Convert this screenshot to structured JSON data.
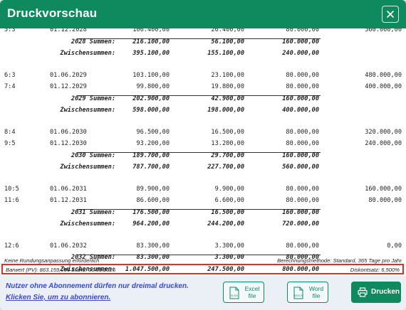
{
  "dialog": {
    "title": "Druckvorschau",
    "close_icon": "close-icon"
  },
  "table": {
    "rows": [
      {
        "type": "row",
        "id": "5:3",
        "date": "01.12.2028",
        "v1": "106.400,00",
        "v2": "26.400,00",
        "v3": "80.000,00",
        "v4": "560.000,00"
      },
      {
        "type": "sum",
        "label": "2028 Summen:",
        "v1": "216.100,00",
        "v2": "56.100,00",
        "v3": "160.000,00",
        "v4": ""
      },
      {
        "type": "sum",
        "label": "Zwischensummen:",
        "v1": "395.100,00",
        "v2": "155.100,00",
        "v3": "240.000,00",
        "v4": ""
      },
      {
        "type": "row",
        "id": "6:3",
        "date": "01.06.2029",
        "v1": "103.100,00",
        "v2": "23.100,00",
        "v3": "80.000,00",
        "v4": "480.000,00"
      },
      {
        "type": "row",
        "id": "7:4",
        "date": "01.12.2029",
        "v1": "99.800,00",
        "v2": "19.800,00",
        "v3": "80.000,00",
        "v4": "400.000,00"
      },
      {
        "type": "sum",
        "label": "2029 Summen:",
        "v1": "202.900,00",
        "v2": "42.900,00",
        "v3": "160.000,00",
        "v4": ""
      },
      {
        "type": "sum",
        "label": "Zwischensummen:",
        "v1": "598.000,00",
        "v2": "198.000,00",
        "v3": "400.000,00",
        "v4": ""
      },
      {
        "type": "row",
        "id": "8:4",
        "date": "01.06.2030",
        "v1": "96.500,00",
        "v2": "16.500,00",
        "v3": "80.000,00",
        "v4": "320.000,00"
      },
      {
        "type": "row",
        "id": "9:5",
        "date": "01.12.2030",
        "v1": "93.200,00",
        "v2": "13.200,00",
        "v3": "80.000,00",
        "v4": "240.000,00"
      },
      {
        "type": "sum",
        "label": "2030 Summen:",
        "v1": "189.700,00",
        "v2": "29.700,00",
        "v3": "160.000,00",
        "v4": ""
      },
      {
        "type": "sum",
        "label": "Zwischensummen:",
        "v1": "787.700,00",
        "v2": "227.700,00",
        "v3": "560.000,00",
        "v4": ""
      },
      {
        "type": "row",
        "id": "10:5",
        "date": "01.06.2031",
        "v1": "89.900,00",
        "v2": "9.900,00",
        "v3": "80.000,00",
        "v4": "160.000,00"
      },
      {
        "type": "row",
        "id": "11:6",
        "date": "01.12.2031",
        "v1": "86.600,00",
        "v2": "6.600,00",
        "v3": "80.000,00",
        "v4": "80.000,00"
      },
      {
        "type": "sum",
        "label": "2031 Summen:",
        "v1": "176.500,00",
        "v2": "16.500,00",
        "v3": "160.000,00",
        "v4": ""
      },
      {
        "type": "sum",
        "label": "Zwischensummen:",
        "v1": "964.200,00",
        "v2": "244.200,00",
        "v3": "720.000,00",
        "v4": ""
      },
      {
        "type": "row",
        "id": "12:6",
        "date": "01.06.2032",
        "v1": "83.300,00",
        "v2": "3.300,00",
        "v3": "80.000,00",
        "v4": "0,00"
      },
      {
        "type": "sum",
        "label": "2032 Summen:",
        "v1": "83.300,00",
        "v2": "3.300,00",
        "v3": "80.000,00",
        "v4": ""
      },
      {
        "type": "sum",
        "label": "Zwischensummen:",
        "v1": "1.047.500,00",
        "v2": "247.500,00",
        "v3": "800.000,00",
        "v4": ""
      }
    ],
    "footnote_left": "Keine Rundungsanpassung erforderlich",
    "footnote_right": "Berechnungsmethode: Standard, 365 Tage pro Jahr",
    "barwert_left": "Barwert (PV): 863.159,06€ Stand: 30.09.2026",
    "barwert_right": "Diskontsatz: 6,500%"
  },
  "footer": {
    "notice_line1": "Nutzer ohne Abonnement dürfen nur dreimal drucken.",
    "notice_link": "Klicken Sie, um zu abonnieren.",
    "excel_label": "Excel file",
    "excel_badge": "XLSX",
    "word_label": "Word file",
    "word_badge": "DOCX",
    "print_label": "Drucken",
    "accent": "#0f8a5f",
    "notice_color": "#3b49c4",
    "highlight_color": "#d9302c"
  }
}
